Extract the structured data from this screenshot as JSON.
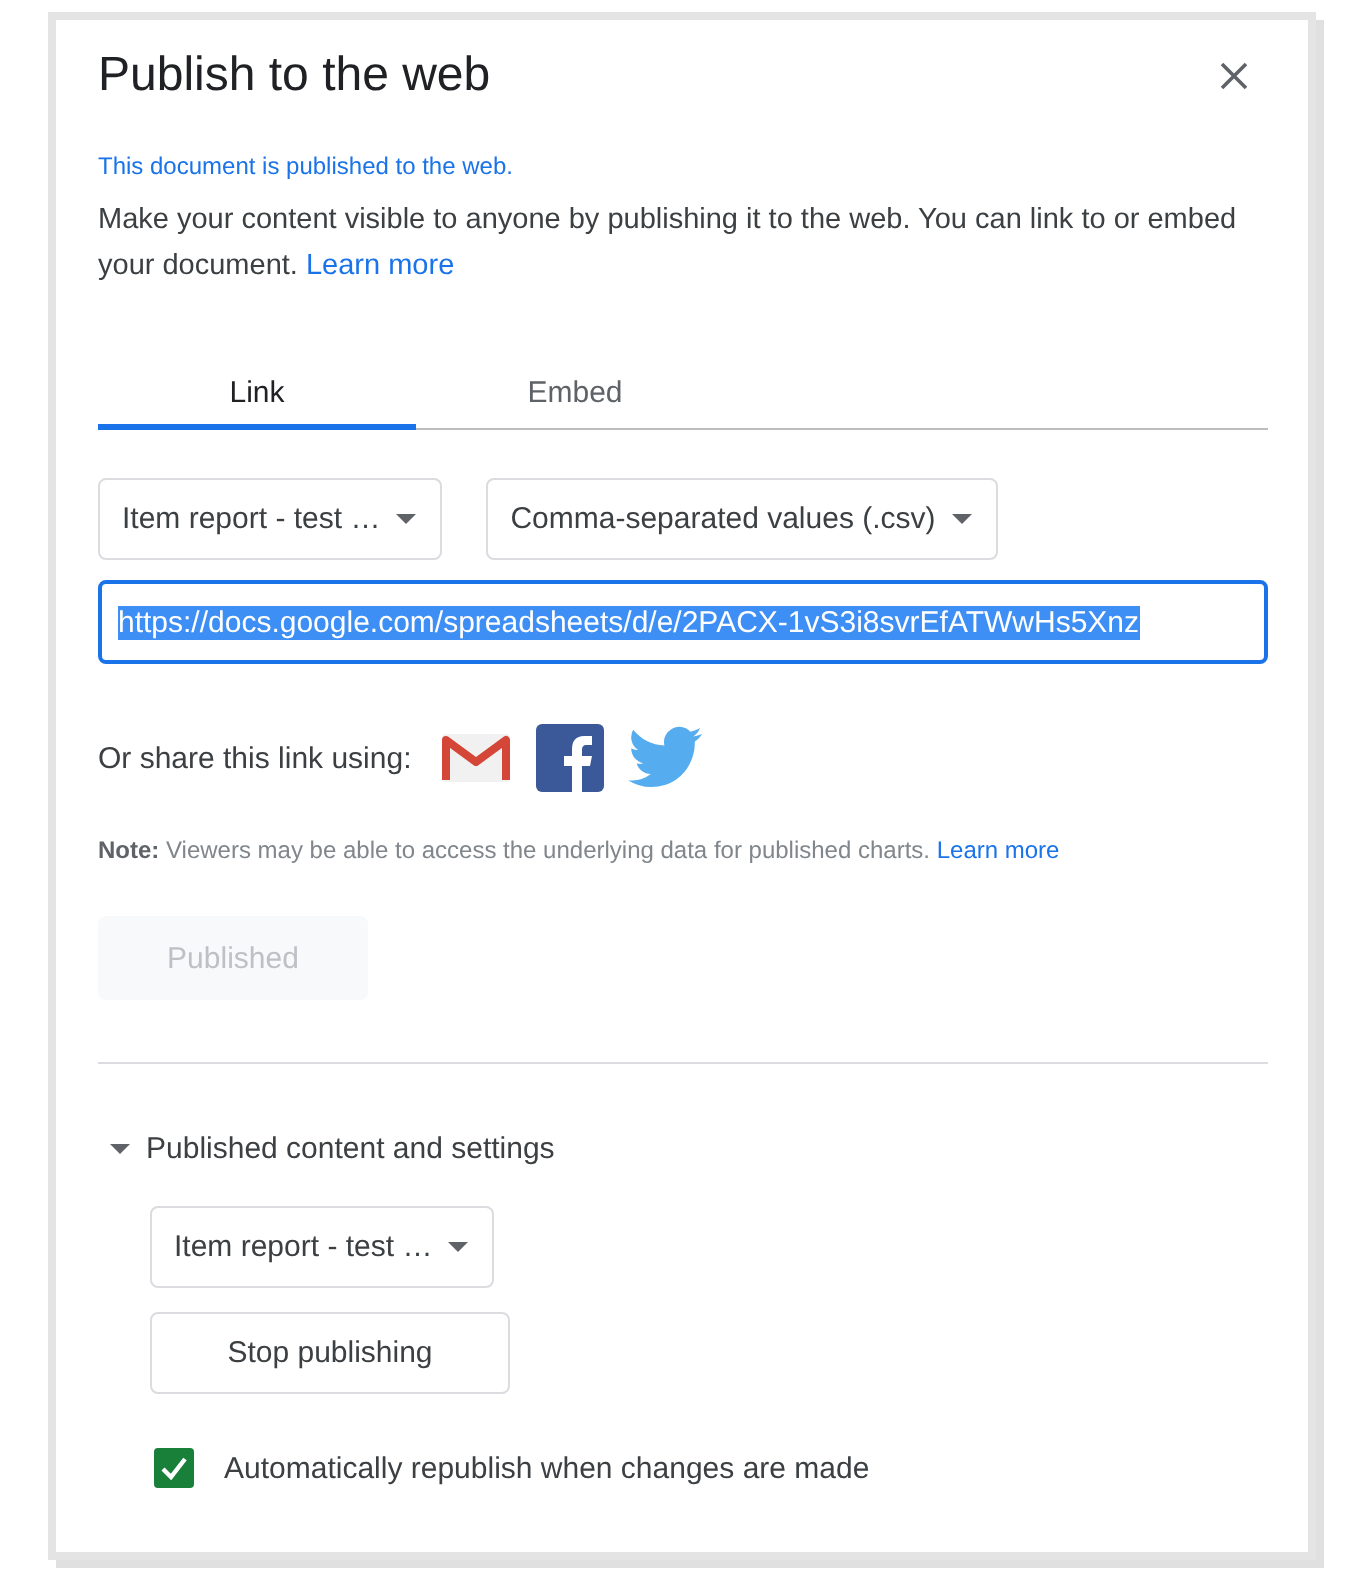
{
  "dialog": {
    "title": "Publish to the web",
    "status": "This document is published to the web.",
    "description": "Make your content visible to anyone by publishing it to the web. You can link to or embed your document.",
    "description_link": "Learn more",
    "tabs": [
      {
        "label": "Link",
        "selected": true
      },
      {
        "label": "Embed",
        "selected": false
      }
    ],
    "selects": [
      {
        "value": "Item report - test …"
      },
      {
        "value": "Comma-separated values (.csv)"
      }
    ],
    "url_field": {
      "value": "https://docs.google.com/spreadsheets/d/e/2PACX-1vS3i8svrEfATWwHs5Xnz",
      "text_selected": true
    },
    "share_label": "Or share this link using:",
    "note": "**Note:** Viewers may be able to access the underlying data for published charts.",
    "note_link": "Learn more",
    "publish_button": {
      "label": "Published",
      "disabled": true
    },
    "settings": {
      "label": "Published content and settings",
      "expanded": true,
      "select": {
        "value": "Item report - test …"
      },
      "stop_button": "Stop publishing",
      "checkbox": {
        "label": "Automatically republish when changes are made",
        "checked": true
      }
    }
  }
}
